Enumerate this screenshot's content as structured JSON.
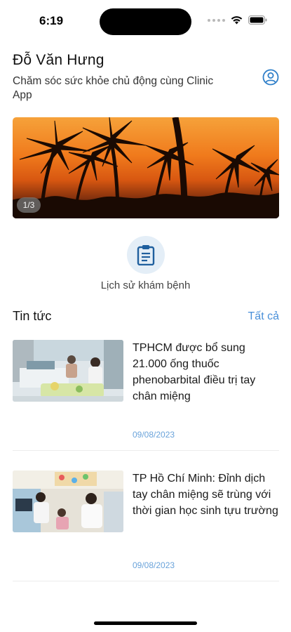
{
  "status_bar": {
    "time": "6:19"
  },
  "header": {
    "user_name": "Đỗ Văn Hưng",
    "subtitle": "Chăm sóc sức khỏe chủ động cùng Clinic App",
    "profile_icon": "user-circle-icon"
  },
  "banner": {
    "counter": "1/3",
    "image": "palm-trees-sunset"
  },
  "quick_action": {
    "label": "Lịch sử khám bệnh",
    "icon": "clipboard-icon"
  },
  "news": {
    "title": "Tin tức",
    "view_all": "Tất cả",
    "items": [
      {
        "headline": "TPHCM được bổ sung 21.000 ống thuốc phenobarbital điều trị tay chân miệng",
        "date": "09/08/2023"
      },
      {
        "headline": "TP Hồ Chí Minh: Đỉnh dịch tay chân miệng sẽ trùng với thời gian học sinh tựu trường",
        "date": "09/08/2023"
      }
    ]
  },
  "colors": {
    "accent": "#4a90d9",
    "date": "#6aa3da",
    "icon_bg": "#e4eef7"
  }
}
